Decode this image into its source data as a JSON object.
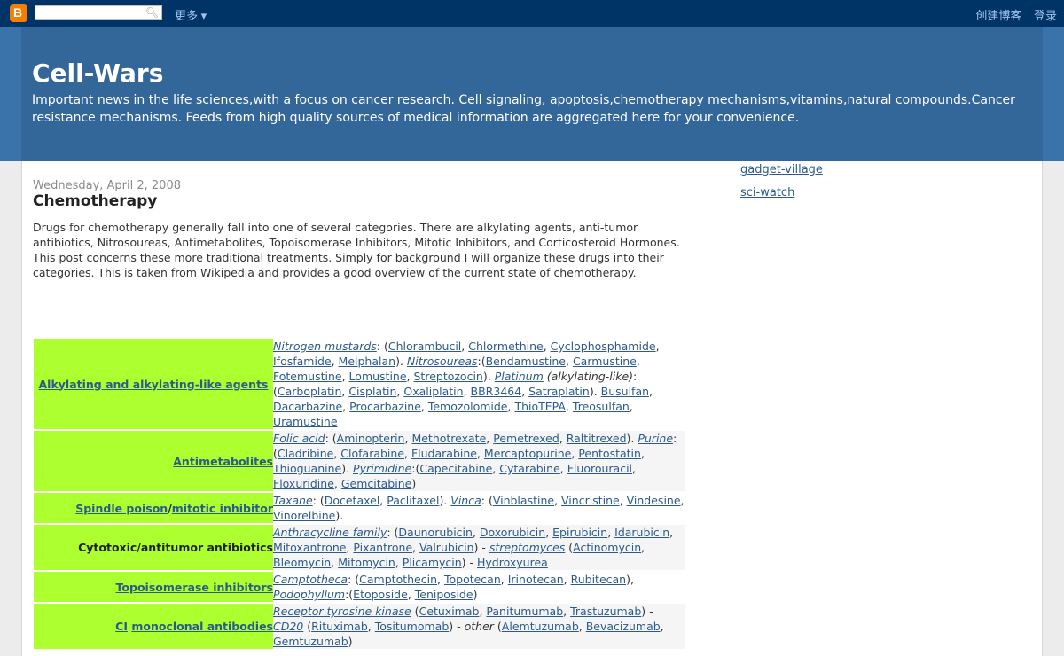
{
  "navbar": {
    "more_label": "更多 ▾",
    "create_blog": "创建博客",
    "login": "登录",
    "search_value": ""
  },
  "header": {
    "title": "Cell-Wars",
    "description": "Important news in the life sciences,with a focus on cancer research. Cell signaling, apoptosis,chemotherapy mechanisms,vitamins,natural compounds.Cancer resistance mechanisms. Feeds from high quality sources of medical information are aggregated here for your convenience."
  },
  "sidebar": {
    "links": [
      "gadget-village",
      "sci-watch"
    ]
  },
  "post": {
    "date": "Wednesday, April 2, 2008",
    "title": "Chemotherapy",
    "body": "Drugs for chemotherapy generally fall into one of several categories. There are alkylating agents, anti-tumor antibiotics, Nitrosoureas, Antimetabolites, Topoisomerase Inhibitors, Mitotic Inhibitors, and Corticosteroid Hormones. This post concerns these more traditional treatments. Simply for background I will organize these drugs into their categories. This is taken from Wikipedia and provides a good overview of the current state of chemotherapy."
  },
  "table": {
    "rows": [
      {
        "category": [
          {
            "t": "Alkylating and alkylating-like agents",
            "link": true
          }
        ],
        "align": "center",
        "drugs": [
          {
            "t": "Nitrogen mustards",
            "i": true,
            "link": true
          },
          {
            "t": ": ("
          },
          {
            "t": "Chlorambucil",
            "link": true
          },
          {
            "t": ", "
          },
          {
            "t": "Chlormethine",
            "link": true
          },
          {
            "t": ", "
          },
          {
            "t": "Cyclophosphamide",
            "link": true
          },
          {
            "t": ", "
          },
          {
            "t": "Ifosfamide",
            "link": true
          },
          {
            "t": ", "
          },
          {
            "t": "Melphalan",
            "link": true
          },
          {
            "t": "). "
          },
          {
            "t": "Nitrosoureas",
            "i": true,
            "link": true
          },
          {
            "t": ":("
          },
          {
            "t": "Bendamustine",
            "link": true
          },
          {
            "t": ", "
          },
          {
            "t": "Carmustine",
            "link": true
          },
          {
            "t": ", "
          },
          {
            "t": "Fotemustine",
            "link": true
          },
          {
            "t": ", "
          },
          {
            "t": "Lomustine",
            "link": true
          },
          {
            "t": ", "
          },
          {
            "t": "Streptozocin",
            "link": true
          },
          {
            "t": "). "
          },
          {
            "t": "Platinum",
            "i": true,
            "link": true
          },
          {
            "t": " (alkylating-like)",
            "i": true
          },
          {
            "t": ": ("
          },
          {
            "t": "Carboplatin",
            "link": true
          },
          {
            "t": ", "
          },
          {
            "t": "Cisplatin",
            "link": true
          },
          {
            "t": ", "
          },
          {
            "t": "Oxaliplatin",
            "link": true
          },
          {
            "t": ", "
          },
          {
            "t": "BBR3464",
            "link": true
          },
          {
            "t": ", "
          },
          {
            "t": "Satraplatin",
            "link": true
          },
          {
            "t": "). "
          },
          {
            "t": "Busulfan",
            "link": true
          },
          {
            "t": ", "
          },
          {
            "t": "Dacarbazine",
            "link": true
          },
          {
            "t": ", "
          },
          {
            "t": "Procarbazine",
            "link": true
          },
          {
            "t": ", "
          },
          {
            "t": "Temozolomide",
            "link": true
          },
          {
            "t": ", "
          },
          {
            "t": "ThioTEPA",
            "link": true
          },
          {
            "t": ", "
          },
          {
            "t": "Treosulfan",
            "link": true
          },
          {
            "t": ", "
          },
          {
            "t": "Uramustine",
            "link": true
          }
        ],
        "shade": false
      },
      {
        "category": [
          {
            "t": "Antimetabolites",
            "link": true
          }
        ],
        "align": "right",
        "drugs": [
          {
            "t": "Folic acid",
            "i": true,
            "link": true
          },
          {
            "t": ": ("
          },
          {
            "t": "Aminopterin",
            "link": true
          },
          {
            "t": ", "
          },
          {
            "t": "Methotrexate",
            "link": true
          },
          {
            "t": ", "
          },
          {
            "t": "Pemetrexed",
            "link": true
          },
          {
            "t": ", "
          },
          {
            "t": "Raltitrexed",
            "link": true
          },
          {
            "t": "). "
          },
          {
            "t": "Purine",
            "i": true,
            "link": true
          },
          {
            "t": ": ("
          },
          {
            "t": "Cladribine",
            "link": true
          },
          {
            "t": ", "
          },
          {
            "t": "Clofarabine",
            "link": true
          },
          {
            "t": ", "
          },
          {
            "t": "Fludarabine",
            "link": true
          },
          {
            "t": ", "
          },
          {
            "t": "Mercaptopurine",
            "link": true
          },
          {
            "t": ", "
          },
          {
            "t": "Pentostatin",
            "link": true
          },
          {
            "t": ", "
          },
          {
            "t": "Thioguanine",
            "link": true
          },
          {
            "t": "). "
          },
          {
            "t": "Pyrimidine",
            "i": true,
            "link": true
          },
          {
            "t": ":("
          },
          {
            "t": "Capecitabine",
            "link": true
          },
          {
            "t": ", "
          },
          {
            "t": "Cytarabine",
            "link": true
          },
          {
            "t": ", "
          },
          {
            "t": "Fluorouracil",
            "link": true
          },
          {
            "t": ", "
          },
          {
            "t": "Floxuridine",
            "link": true
          },
          {
            "t": ", "
          },
          {
            "t": "Gemcitabine",
            "link": true
          },
          {
            "t": ")"
          }
        ],
        "shade": true
      },
      {
        "category": [
          {
            "t": "Spindle poison",
            "link": true
          },
          {
            "t": "/"
          },
          {
            "t": "mitotic inhibitor",
            "link": true
          }
        ],
        "align": "right",
        "drugs": [
          {
            "t": "Taxane",
            "i": true,
            "link": true
          },
          {
            "t": ": ("
          },
          {
            "t": "Docetaxel",
            "link": true
          },
          {
            "t": ", "
          },
          {
            "t": "Paclitaxel",
            "link": true
          },
          {
            "t": "). "
          },
          {
            "t": "Vinca",
            "i": true,
            "link": true
          },
          {
            "t": ": ("
          },
          {
            "t": "Vinblastine",
            "link": true
          },
          {
            "t": ", "
          },
          {
            "t": "Vincristine",
            "link": true
          },
          {
            "t": ", "
          },
          {
            "t": "Vindesine",
            "link": true
          },
          {
            "t": ", "
          },
          {
            "t": "Vinorelbine",
            "link": true
          },
          {
            "t": ")."
          }
        ],
        "shade": false
      },
      {
        "category": [
          {
            "t": "Cytotoxic/antitumor antibiotics"
          }
        ],
        "align": "right",
        "drugs": [
          {
            "t": "Anthracycline family",
            "i": true,
            "link": true
          },
          {
            "t": ": ("
          },
          {
            "t": "Daunorubicin",
            "link": true
          },
          {
            "t": ", "
          },
          {
            "t": "Doxorubicin",
            "link": true
          },
          {
            "t": ", "
          },
          {
            "t": "Epirubicin",
            "link": true
          },
          {
            "t": ", "
          },
          {
            "t": "Idarubicin",
            "link": true
          },
          {
            "t": ", "
          },
          {
            "t": "Mitoxantrone",
            "link": true
          },
          {
            "t": ", "
          },
          {
            "t": "Pixantrone",
            "link": true
          },
          {
            "t": ", "
          },
          {
            "t": "Valrubicin",
            "link": true
          },
          {
            "t": ") - "
          },
          {
            "t": "streptomyces",
            "i": true,
            "link": true
          },
          {
            "t": " ("
          },
          {
            "t": "Actinomycin",
            "link": true
          },
          {
            "t": ", "
          },
          {
            "t": "Bleomycin",
            "link": true
          },
          {
            "t": ", "
          },
          {
            "t": "Mitomycin",
            "link": true
          },
          {
            "t": ", "
          },
          {
            "t": "Plicamycin",
            "link": true
          },
          {
            "t": ") - "
          },
          {
            "t": "Hydroxyurea",
            "link": true
          }
        ],
        "shade": true
      },
      {
        "category": [
          {
            "t": "Topoisomerase inhibitors",
            "link": true
          }
        ],
        "align": "right",
        "drugs": [
          {
            "t": "Camptotheca",
            "i": true,
            "link": true
          },
          {
            "t": ": ("
          },
          {
            "t": "Camptothecin",
            "link": true
          },
          {
            "t": ", "
          },
          {
            "t": "Topotecan",
            "link": true
          },
          {
            "t": ", "
          },
          {
            "t": "Irinotecan",
            "link": true
          },
          {
            "t": ", "
          },
          {
            "t": "Rubitecan",
            "link": true
          },
          {
            "t": "), "
          },
          {
            "t": "Podophyllum",
            "i": true,
            "link": true
          },
          {
            "t": ":("
          },
          {
            "t": "Etoposide",
            "link": true
          },
          {
            "t": ", "
          },
          {
            "t": "Teniposide",
            "link": true
          },
          {
            "t": ")"
          }
        ],
        "shade": false
      },
      {
        "category": [
          {
            "t": "CI",
            "link": true
          },
          {
            "t": " "
          },
          {
            "t": "monoclonal antibodies",
            "link": true
          }
        ],
        "align": "right",
        "drugs": [
          {
            "t": "Receptor tyrosine kinase",
            "i": true,
            "link": true
          },
          {
            "t": " ("
          },
          {
            "t": "Cetuximab",
            "link": true
          },
          {
            "t": ", "
          },
          {
            "t": "Panitumumab",
            "link": true
          },
          {
            "t": ", "
          },
          {
            "t": "Trastuzumab",
            "link": true
          },
          {
            "t": ") - "
          },
          {
            "t": "CD20",
            "i": true,
            "link": true
          },
          {
            "t": " ("
          },
          {
            "t": "Rituximab",
            "link": true
          },
          {
            "t": ", "
          },
          {
            "t": "Tositumomab",
            "link": true
          },
          {
            "t": ") - "
          },
          {
            "t": "other",
            "i": true
          },
          {
            "t": " ("
          },
          {
            "t": "Alemtuzumab",
            "link": true
          },
          {
            "t": ", "
          },
          {
            "t": "Bevacizumab",
            "link": true
          },
          {
            "t": ", "
          },
          {
            "t": "Gemtuzumab",
            "link": true
          },
          {
            "t": ")"
          }
        ],
        "shade": true
      }
    ]
  },
  "colors": {
    "navbar": "#003366",
    "header": "#336699",
    "category_cell": "#adff2f",
    "link": "#2b5a8c"
  }
}
